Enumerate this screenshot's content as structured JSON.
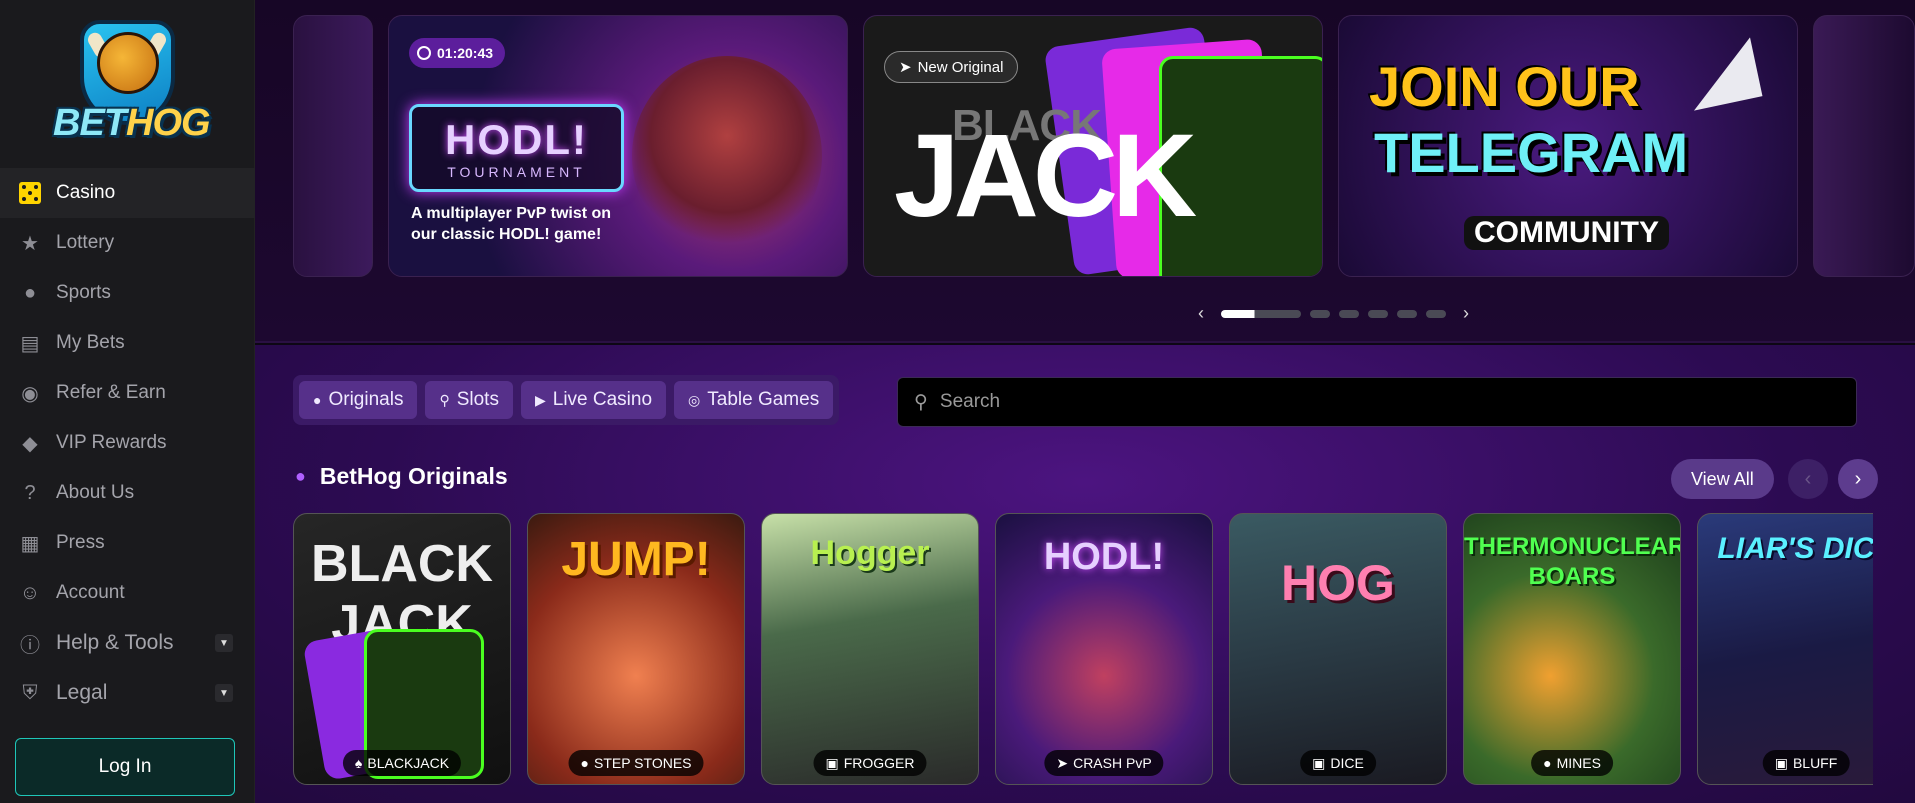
{
  "sidebar": {
    "brand_word_a": "BET",
    "brand_word_b": "HOG",
    "items": [
      {
        "label": "Casino",
        "icon": "dice-icon"
      },
      {
        "label": "Lottery",
        "icon": "ticket-icon"
      },
      {
        "label": "Sports",
        "icon": "ball-icon"
      },
      {
        "label": "My Bets",
        "icon": "receipt-icon"
      },
      {
        "label": "Refer & Earn",
        "icon": "piggy-bank-icon"
      },
      {
        "label": "VIP Rewards",
        "icon": "diamond-icon"
      },
      {
        "label": "About Us",
        "icon": "question-icon"
      },
      {
        "label": "Press",
        "icon": "newspaper-icon"
      },
      {
        "label": "Account",
        "icon": "user-icon"
      },
      {
        "label": "Help & Tools",
        "icon": "info-icon"
      },
      {
        "label": "Legal",
        "icon": "shield-icon"
      }
    ],
    "login_label": "Log In"
  },
  "banners": {
    "hodl": {
      "timer": "01:20:43",
      "title": "HODL!",
      "subtitle": "TOURNAMENT",
      "description": "A multiplayer PvP twist on our classic HODL! game!"
    },
    "blackjack": {
      "badge": "New Original",
      "word1": "BLACK",
      "word2": "JACK"
    },
    "telegram": {
      "line1": "JOIN OUR",
      "line2": "TELEGRAM",
      "line3": "COMMUNITY"
    }
  },
  "categories": [
    {
      "label": "Originals",
      "icon": "person-icon"
    },
    {
      "label": "Slots",
      "icon": "joystick-icon"
    },
    {
      "label": "Live Casino",
      "icon": "play-icon"
    },
    {
      "label": "Table Games",
      "icon": "chip-icon"
    }
  ],
  "search": {
    "placeholder": "Search"
  },
  "section": {
    "title": "BetHog Originals",
    "view_all": "View All"
  },
  "games": [
    {
      "label": "BLACKJACK",
      "art": "BLACK JACK",
      "color": "#1b1b1b"
    },
    {
      "label": "STEP STONES",
      "art": "JUMP!",
      "color": "#c23a22"
    },
    {
      "label": "FROGGER",
      "art": "Hogger",
      "color": "#3a5a3a"
    },
    {
      "label": "CRASH PvP",
      "art": "HODL!",
      "color": "#3a2a7a"
    },
    {
      "label": "DICE",
      "art": "HOG",
      "color": "#2d4a55"
    },
    {
      "label": "MINES",
      "art": "THERMONUCLEAR BOARS",
      "color": "#2a5a2a"
    },
    {
      "label": "BLUFF",
      "art": "LIAR'S DICE",
      "color": "#242a5a"
    }
  ],
  "colors": {
    "accent": "#ffd400",
    "login_border": "#1fc6b8",
    "main_bg": "#4c1480"
  }
}
